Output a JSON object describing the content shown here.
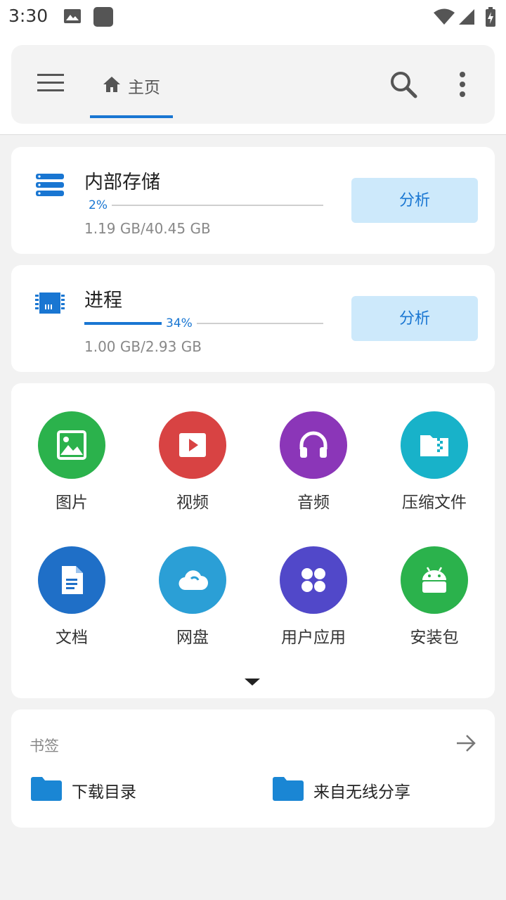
{
  "status_bar": {
    "time": "3:30",
    "icons": [
      "image-icon",
      "app-square-icon",
      "wifi-icon",
      "signal-icon",
      "battery-charging-icon"
    ]
  },
  "app_bar": {
    "tab_home_label": "主页",
    "icons": [
      "menu-icon",
      "home-icon",
      "search-icon",
      "more-vert-icon"
    ]
  },
  "storage": [
    {
      "title": "内部存储",
      "percent_label": "2%",
      "percent": 2,
      "size": "1.19 GB/40.45 GB",
      "button": "分析",
      "icon": "storage-icon"
    },
    {
      "title": "进程",
      "percent_label": "34%",
      "percent": 34,
      "size": "1.00 GB/2.93 GB",
      "button": "分析",
      "icon": "memory-chip-icon"
    }
  ],
  "categories": [
    {
      "label": "图片",
      "color": "#2bb24c",
      "icon": "image-icon"
    },
    {
      "label": "视频",
      "color": "#d84343",
      "icon": "video-icon"
    },
    {
      "label": "音频",
      "color": "#8b36b8",
      "icon": "headphones-icon"
    },
    {
      "label": "压缩文件",
      "color": "#18b2c9",
      "icon": "zip-folder-icon"
    },
    {
      "label": "文档",
      "color": "#1f6fc7",
      "icon": "document-icon"
    },
    {
      "label": "网盘",
      "color": "#2b9fd6",
      "icon": "cloud-icon"
    },
    {
      "label": "用户应用",
      "color": "#5148c9",
      "icon": "apps-icon"
    },
    {
      "label": "安装包",
      "color": "#2bb24c",
      "icon": "android-icon"
    }
  ],
  "bookmarks": {
    "title": "书签",
    "items": [
      {
        "label": "下载目录",
        "icon": "folder-icon"
      },
      {
        "label": "来自无线分享",
        "icon": "folder-icon"
      }
    ]
  },
  "colors": {
    "accent": "#1976d2",
    "button_bg": "#cde9fb",
    "folder": "#1a86d4"
  }
}
